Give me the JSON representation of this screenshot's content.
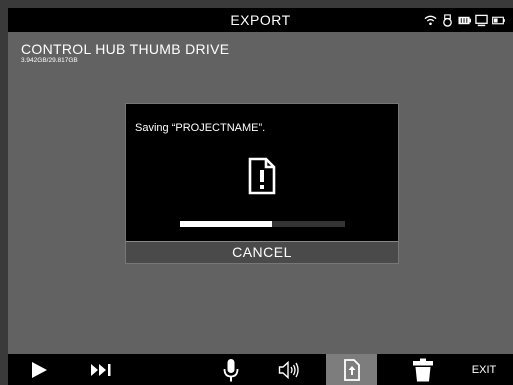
{
  "header": {
    "title": "EXPORT",
    "status_icons": [
      "wifi-icon",
      "usb-drive-icon",
      "battery-icon",
      "monitor-icon",
      "battery-level-icon"
    ]
  },
  "device": {
    "name": "CONTROL HUB THUMB DRIVE",
    "capacity": "3.942GB/29.817GB"
  },
  "dialog": {
    "message": "Saving “PROJECTNAME”.",
    "icon": "document-alert-icon",
    "progress": 0.56,
    "cancel_label": "CANCEL"
  },
  "toolbar": {
    "buttons": [
      "play-icon",
      "skip-forward-icon",
      "microphone-icon",
      "speaker-icon",
      "export-icon",
      "trash-icon"
    ],
    "exit_label": "EXIT"
  },
  "colors": {
    "background": "#626262",
    "bar": "#000000",
    "active": "#7d7d7d"
  }
}
